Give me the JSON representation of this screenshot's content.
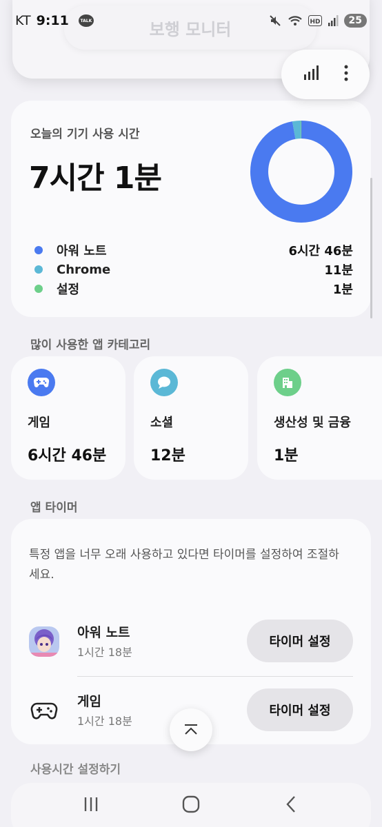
{
  "status_bar": {
    "carrier": "KT",
    "time": "9:11",
    "talk_badge": "TALK",
    "hd_label": "HD",
    "battery": "25",
    "icons": [
      "talk-icon",
      "mute-icon",
      "wifi-icon",
      "hd-icon",
      "signal-icon",
      "battery-icon"
    ]
  },
  "header": {
    "title": "보행 모니터",
    "actions": [
      "bar-chart-icon",
      "more-vertical-icon"
    ]
  },
  "usage": {
    "label": "오늘의 기기 사용 시간",
    "total": "7시간 1분",
    "apps": [
      {
        "name": "아워 노트",
        "time": "6시간 46분",
        "color": "#4a7af0",
        "minutes": 406
      },
      {
        "name": "Chrome",
        "time": "11분",
        "color": "#5bb8d6",
        "minutes": 11
      },
      {
        "name": "설정",
        "time": "1분",
        "color": "#6dcf8a",
        "minutes": 1
      }
    ]
  },
  "categories": {
    "title": "많이 사용한 앱 카테고리",
    "items": [
      {
        "name": "게임",
        "time": "6시간 46분",
        "icon": "gamepad-icon",
        "color": "#4a7af0"
      },
      {
        "name": "소셜",
        "time": "12분",
        "icon": "chat-bubble-icon",
        "color": "#5bb8d6"
      },
      {
        "name": "생산성 및 금융",
        "time": "1분",
        "icon": "building-icon",
        "color": "#6dcf8a"
      }
    ]
  },
  "app_timer": {
    "title": "앱 타이머",
    "description": "특정 앱을 너무 오래 사용하고 있다면 타이머를 설정하여 조절하세요.",
    "rows": [
      {
        "name": "아워 노트",
        "sub": "1시간 18분",
        "button": "타이머 설정",
        "icon": "app-avatar-icon"
      },
      {
        "name": "게임",
        "sub": "1시간 18분",
        "button": "타이머 설정",
        "icon": "gamepad-outline-icon"
      }
    ]
  },
  "bottom_section": {
    "title": "사용시간 설정하기"
  },
  "nav": {
    "buttons": [
      "recent-apps-icon",
      "home-icon",
      "back-icon"
    ]
  }
}
